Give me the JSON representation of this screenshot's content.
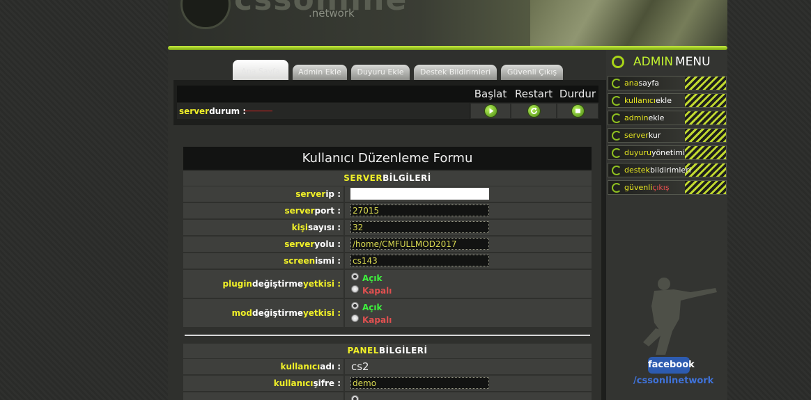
{
  "header": {
    "logo_text": "cssonline",
    "logo_sub": ".network"
  },
  "tabs": [
    {
      "label": "Ana Sayfa",
      "active": true
    },
    {
      "label": "Admin Ekle"
    },
    {
      "label": "Duyuru Ekle"
    },
    {
      "label": "Destek Bildirimleri"
    },
    {
      "label": "Güvenli Çıkış"
    }
  ],
  "controls": {
    "start_label": "Başlat",
    "restart_label": "Restart",
    "stop_label": "Durdur",
    "status_prefix": "server",
    "status_rest": "durum :"
  },
  "form": {
    "title": "Kullanıcı Düzenleme Formu",
    "server_section": {
      "y": "SERVER",
      "w": "BİLGİLERİ"
    },
    "panel_section": {
      "y": "PANEL",
      "w": "BİLGİLERİ"
    },
    "fields": {
      "server_ip": {
        "label_y": "server",
        "label_w": "ip :",
        "value": ""
      },
      "server_port": {
        "label_y": "server",
        "label_w": "port :",
        "value": "27015"
      },
      "slots": {
        "label_y": "kişi",
        "label_w": "sayısı :",
        "value": "32"
      },
      "server_path": {
        "label_y": "server",
        "label_w": "yolu :",
        "value": "/home/CMFULLMOD2017"
      },
      "screen_name": {
        "label_y": "screen",
        "label_w": "ismi :",
        "value": "cs143"
      },
      "plugin_perm": {
        "label_1y": "plugin",
        "label_2w": "değiştirme",
        "label_3y": "yetkisi :"
      },
      "mod_perm": {
        "label_1y": "mod",
        "label_2w": "değiştirme",
        "label_3y": "yetkisi :"
      },
      "username": {
        "label_y": "kullanıcı",
        "label_w": "adı :",
        "value": "cs2"
      },
      "password": {
        "label_y": "kullanıcı",
        "label_w": "şifre :",
        "value": "demo"
      }
    },
    "radio_open": "Açık",
    "radio_closed": "Kapalı"
  },
  "sidebar": {
    "title_admin": "ADMIN",
    "title_menu": "MENU",
    "items": [
      {
        "y": "ana",
        "w": "sayfa"
      },
      {
        "y": "kullanıcı",
        "w": "ekle"
      },
      {
        "y": "admin",
        "w": "ekle"
      },
      {
        "y": "server",
        "w": "kur"
      },
      {
        "y": "duyuru",
        "w": "yönetimi"
      },
      {
        "y": "destek",
        "w": "bildirimleri"
      },
      {
        "y": "güvenli",
        "r": "çıkış"
      }
    ],
    "facebook_label": "facebook",
    "facebook_handle": "/cssonlinetwork"
  }
}
